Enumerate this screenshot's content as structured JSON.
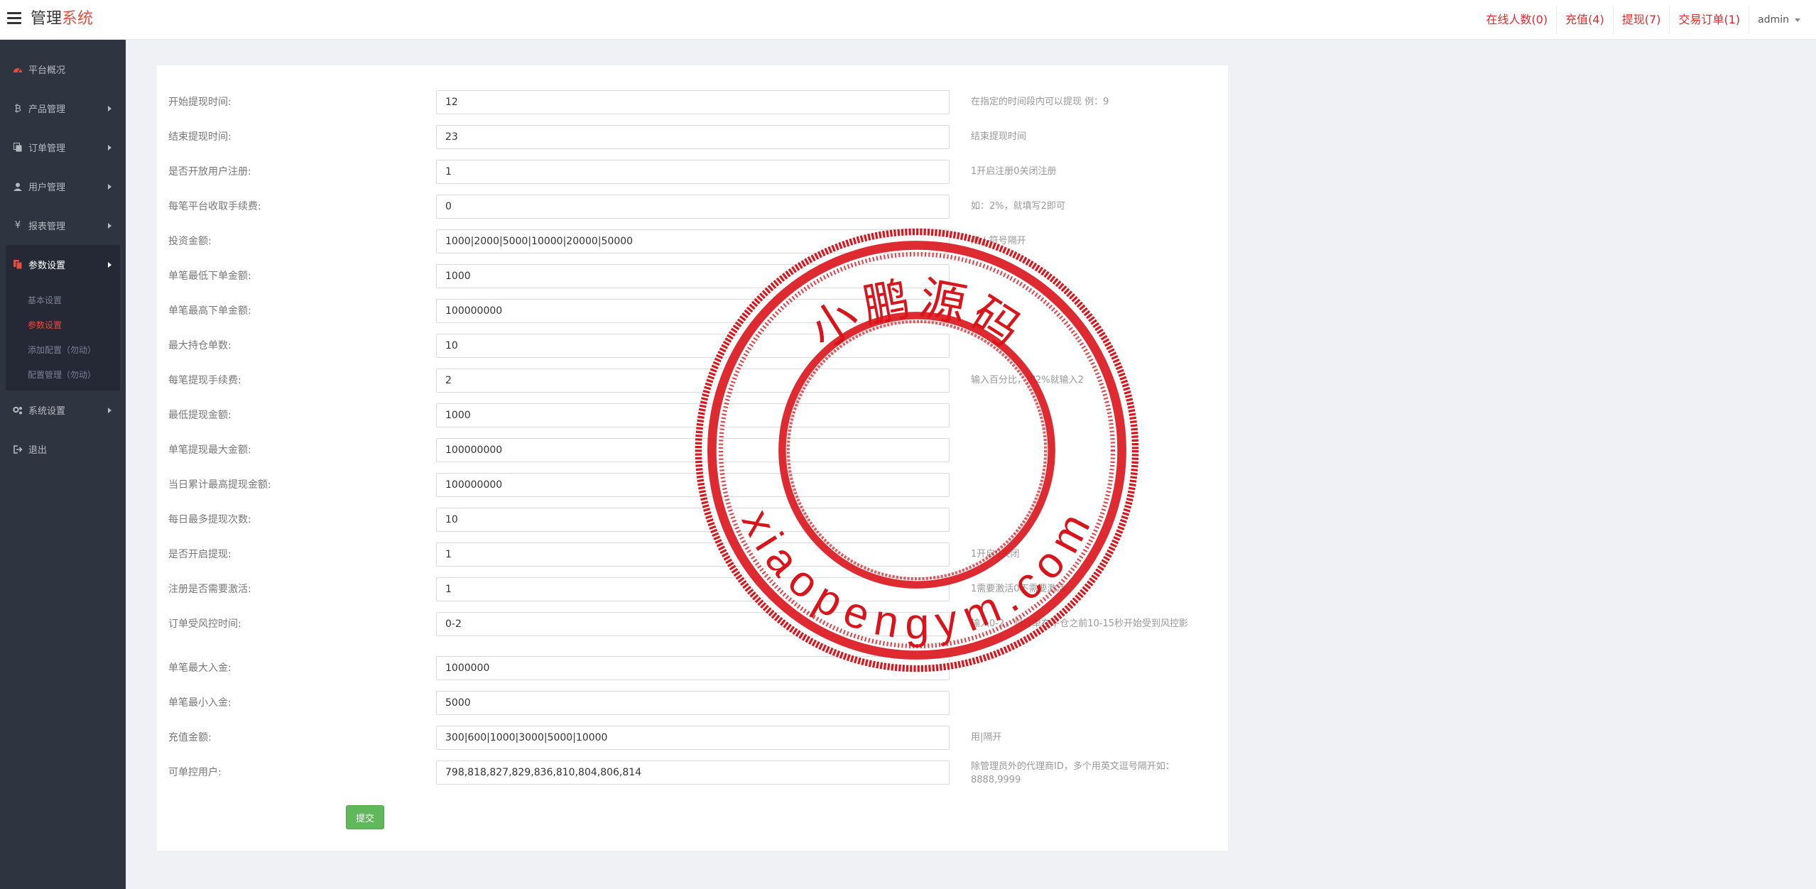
{
  "header": {
    "menu_icon": "hamburger-icon",
    "title_main": "管理",
    "title_accent": "系统",
    "links": [
      "在线人数(0)",
      "充值(4)",
      "提现(7)",
      "交易订单(1)"
    ],
    "user": "admin",
    "accent_color": "#e5292b"
  },
  "sidebar": {
    "items": [
      {
        "label": "平台概况",
        "icon": "dashboard-icon"
      },
      {
        "label": "产品管理",
        "icon": "bitcoin-icon"
      },
      {
        "label": "订单管理",
        "icon": "copy-icon"
      },
      {
        "label": "用户管理",
        "icon": "user-icon"
      },
      {
        "label": "报表管理",
        "icon": "yen-icon"
      },
      {
        "label": "参数设置",
        "icon": "files-icon"
      },
      {
        "label": "系统设置",
        "icon": "gears-icon"
      },
      {
        "label": "退出",
        "icon": "sign-out-icon"
      }
    ],
    "submenu": [
      "基本设置",
      "参数设置",
      "添加配置（勿动）",
      "配置管理（勿动）"
    ]
  },
  "form": {
    "rows": [
      {
        "label": "开始提现时间:",
        "value": "12",
        "hint": "在指定的时间段内可以提现 例：9"
      },
      {
        "label": "结束提现时间:",
        "value": "23",
        "hint": "结束提现时间"
      },
      {
        "label": "是否开放用户注册:",
        "value": "1",
        "hint": "1开启注册0关闭注册"
      },
      {
        "label": "每笔平台收取手续费:",
        "value": "0",
        "hint": "如：2%，就填写2即可"
      },
      {
        "label": "投资金额:",
        "value": "1000|2000|5000|10000|20000|50000",
        "hint": "用 | 符号隔开"
      },
      {
        "label": "单笔最低下单金额:",
        "value": "1000",
        "hint": ""
      },
      {
        "label": "单笔最高下单金额:",
        "value": "100000000",
        "hint": ""
      },
      {
        "label": "最大持仓单数:",
        "value": "10",
        "hint": ""
      },
      {
        "label": "每笔提现手续费:",
        "value": "2",
        "hint": "输入百分比，如2%就输入2"
      },
      {
        "label": "最低提现金额:",
        "value": "1000",
        "hint": ""
      },
      {
        "label": "单笔提现最大金额:",
        "value": "100000000",
        "hint": ""
      },
      {
        "label": "当日累计最高提现金额:",
        "value": "100000000",
        "hint": ""
      },
      {
        "label": "每日最多提现次数:",
        "value": "10",
        "hint": ""
      },
      {
        "label": "是否开启提现:",
        "value": "1",
        "hint": "1开启0关闭"
      },
      {
        "label": "注册是否需要激活:",
        "value": "1",
        "hint": "1需要激活0不需要激活"
      },
      {
        "label": "订单受风控时间:",
        "value": "0-2",
        "hint": "输入0-2，则订单在平仓之前10-15秒开始受到风控影"
      },
      {
        "label": "单笔最大入金:",
        "value": "1000000",
        "hint": ""
      },
      {
        "label": "单笔最小入金:",
        "value": "5000",
        "hint": ""
      },
      {
        "label": "充值金额:",
        "value": "300|600|1000|3000|5000|10000",
        "hint": "用|隔开"
      },
      {
        "label": "可单控用户:",
        "value": "798,818,827,829,836,810,804,806,814",
        "hint": "除管理员外的代理商ID，多个用英文逗号隔开如：8888,9999"
      }
    ],
    "submit_label": "提交"
  },
  "watermark": {
    "text_cn": "小鹏源码",
    "text_en": "xiaopengym.com",
    "color": "#d9141b"
  }
}
